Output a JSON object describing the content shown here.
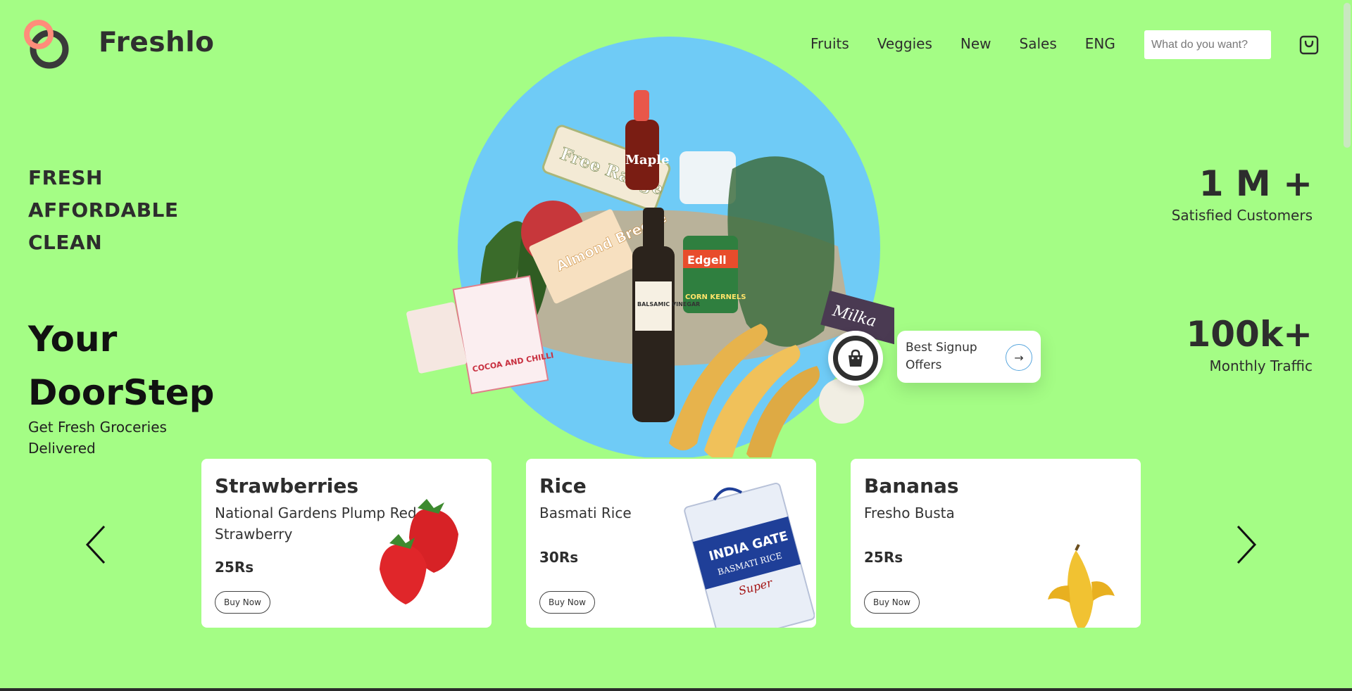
{
  "brand": {
    "name": "Freshlo"
  },
  "nav": {
    "items": [
      "Fruits",
      "Veggies",
      "New",
      "Sales",
      "ENG"
    ]
  },
  "search": {
    "placeholder": "What do you want?"
  },
  "hero": {
    "taglines": [
      "FRESH",
      "AFFORDABLE",
      "CLEAN"
    ],
    "headline_line1": "Your",
    "headline_line2": "DoorStep",
    "subtext": "Get Fresh Groceries Delivered"
  },
  "stats": [
    {
      "value": "1 M +",
      "label": "Satisfied Customers"
    },
    {
      "value": "100k+",
      "label": "Monthly Traffic"
    }
  ],
  "offer": {
    "label": "Best Signup Offers"
  },
  "products": [
    {
      "name": "Strawberries",
      "description": "National Gardens Plump Red Strawberry",
      "price": "25Rs",
      "button": "Buy Now"
    },
    {
      "name": "Rice",
      "description": "Basmati Rice",
      "price": "30Rs",
      "button": "Buy Now"
    },
    {
      "name": "Bananas",
      "description": "Fresho Busta",
      "price": "25Rs",
      "button": "Buy Now"
    }
  ],
  "hero_image_labels": {
    "free_range": "Free Range",
    "maple": "Maple",
    "almond": "Almond Breeze",
    "edgell": "Edgell",
    "corn": "CORN KERNELS",
    "vinegar": "BALSAMIC VINEGAR",
    "cocoa": "COCOA AND CHILLI",
    "milka": "Milka"
  },
  "rice_bag_labels": {
    "brand": "INDIA GATE",
    "type": "BASMATI RICE",
    "grade": "Super"
  },
  "colors": {
    "background": "#a4fd85",
    "hero_circle": "#6fcbf6",
    "logo_ring": "#ff8d7a",
    "text_dark": "#2d2d2d",
    "offer_arrow": "#5aa7de"
  }
}
